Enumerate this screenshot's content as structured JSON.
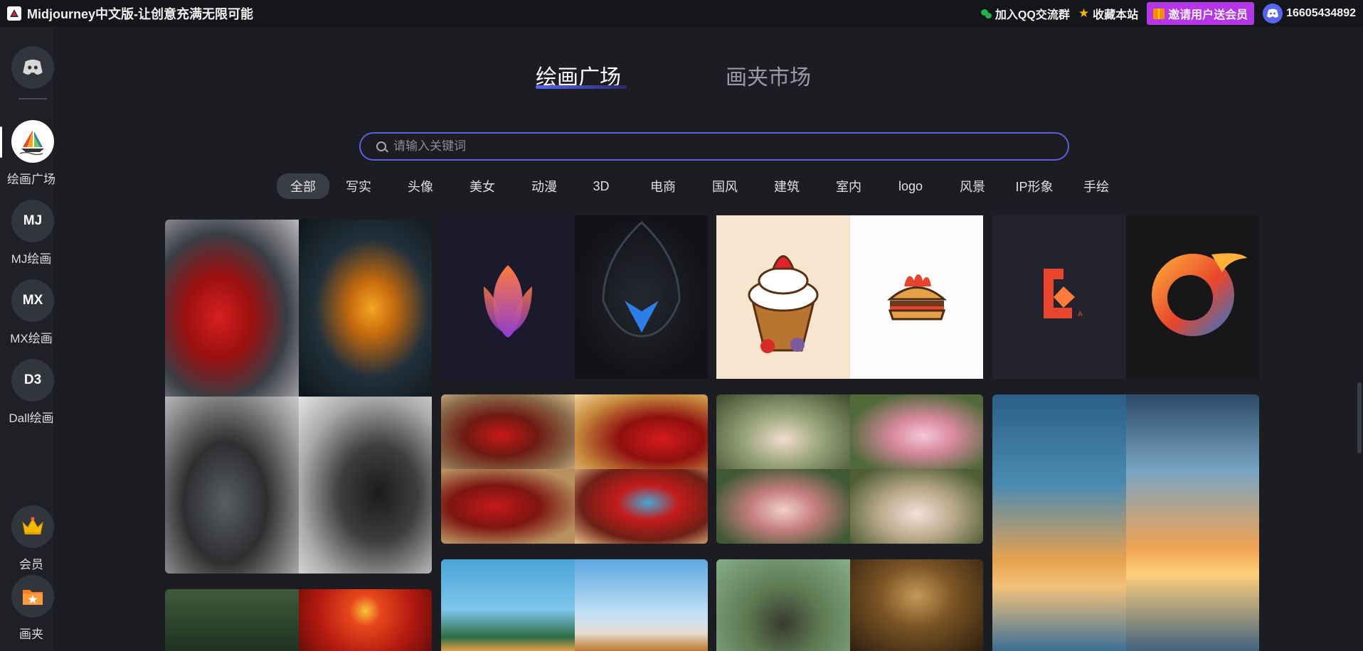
{
  "app": {
    "title": "Midjourney中文版-让创意充满无限可能"
  },
  "top_actions": {
    "qq_group": "加入QQ交流群",
    "bookmark": "收藏本站",
    "invite": "邀请用户送会员",
    "user_id": "16605434892"
  },
  "sidebar": {
    "items": [
      {
        "label": "绘画广场",
        "icon": "sailboat-logo-icon"
      },
      {
        "label": "MJ绘画",
        "icon_text": "MJ"
      },
      {
        "label": "MX绘画",
        "icon_text": "MX"
      },
      {
        "label": "Dall绘画",
        "icon_text": "D3"
      },
      {
        "label": "会员",
        "icon": "crown-icon"
      },
      {
        "label": "画夹",
        "icon": "folder-star-icon"
      }
    ]
  },
  "tabs": {
    "plaza": "绘画广场",
    "market": "画夹市场"
  },
  "search": {
    "placeholder": "请输入关键词"
  },
  "categories": [
    "全部",
    "写实",
    "头像",
    "美女",
    "动漫",
    "3D",
    "电商",
    "国风",
    "建筑",
    "室内",
    "logo",
    "风景",
    "IP形象",
    "手绘"
  ],
  "active_category": "全部",
  "colors": {
    "accent": "#5865f2",
    "invite": "#b535e8",
    "background": "#1c1d22"
  },
  "gallery": {
    "cards": [
      {
        "name": "sports-cars-red-orange"
      },
      {
        "name": "sports-cars-silver-black"
      },
      {
        "name": "lake-sunset"
      },
      {
        "name": "logos-flame-wing"
      },
      {
        "name": "red-cars-street"
      },
      {
        "name": "tropical-building"
      },
      {
        "name": "logos-cupcake-burger"
      },
      {
        "name": "pink-dress-garden"
      },
      {
        "name": "jungle-temple"
      },
      {
        "name": "logos-letter-swirl"
      },
      {
        "name": "airport-terminal-sunset"
      }
    ]
  }
}
